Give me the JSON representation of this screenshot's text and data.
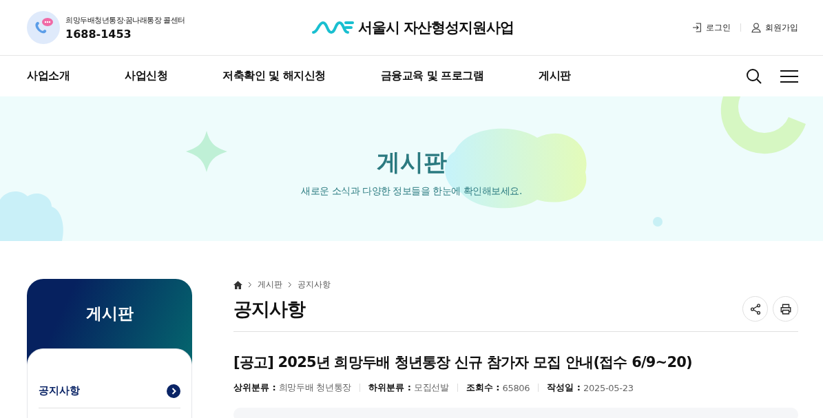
{
  "header": {
    "callcenter_label": "희망두배청년통장·꿈나래통장 콜센터",
    "phone": "1688-1453",
    "site_title": "서울시 자산형성지원사업",
    "links": [
      {
        "kind": "login",
        "label": "로그인"
      },
      {
        "kind": "join",
        "label": "회원가입"
      }
    ]
  },
  "nav": {
    "items": [
      "사업소개",
      "사업신청",
      "저축확인 및 해지신청",
      "금융교육 및 프로그램",
      "게시판"
    ]
  },
  "banner": {
    "title": "게시판",
    "subtitle": "새로운 소식과 다양한 정보들을 한눈에 확인해보세요."
  },
  "sidebar": {
    "title": "게시판",
    "items": [
      {
        "label": "공지사항",
        "selected": true
      }
    ]
  },
  "breadcrumb": [
    "게시판",
    "공지사항"
  ],
  "page_title": "공지사항",
  "post": {
    "title": "[공고] 2025년 희망두배 청년통장 신규 참가자 모집 안내(접수 6/9~20)",
    "meta": [
      {
        "label": "상위분류 :",
        "value": "희망두배 청년통장"
      },
      {
        "label": "하위분류 :",
        "value": "모집선발"
      },
      {
        "label": "조회수 :",
        "value": "65806"
      },
      {
        "label": "작성일 :",
        "value": "2025-05-23"
      }
    ]
  }
}
